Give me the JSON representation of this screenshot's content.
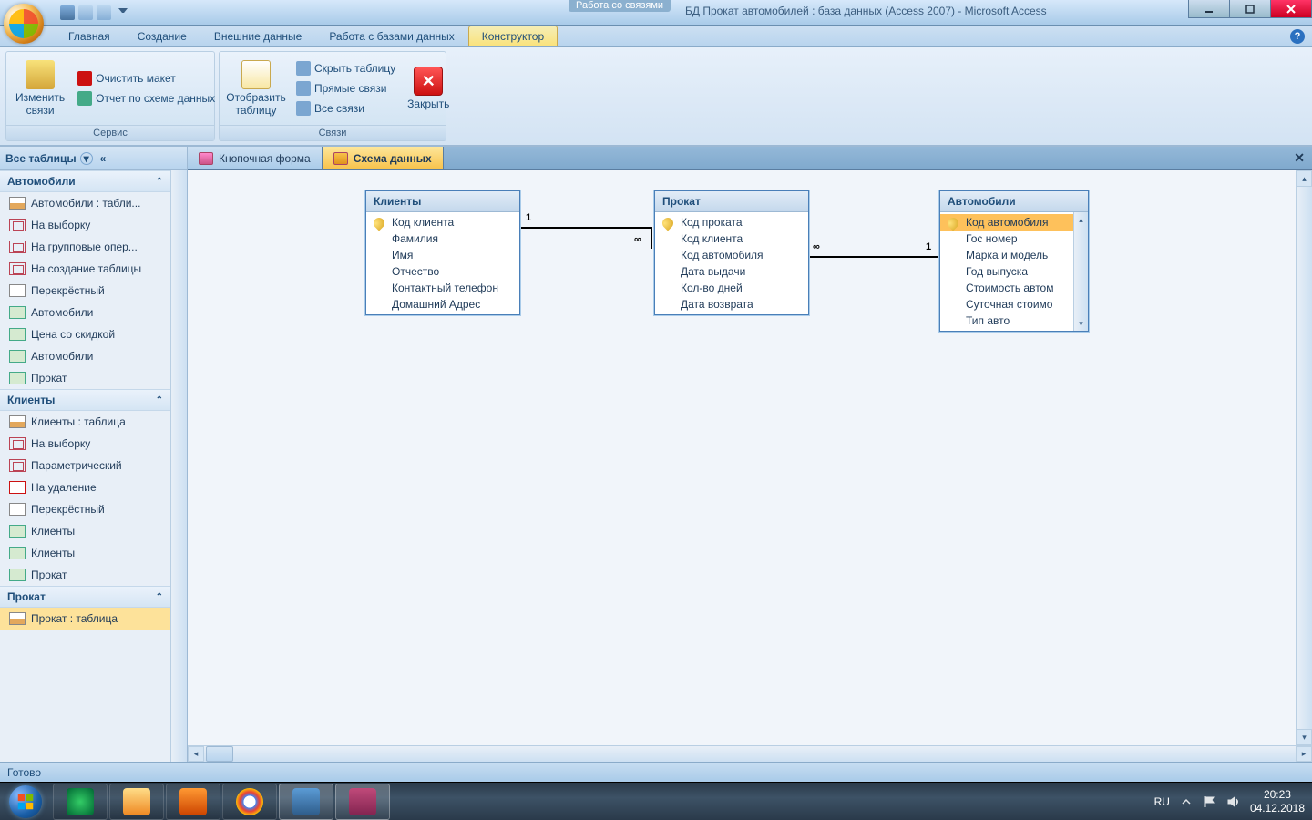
{
  "titlebar": {
    "context_tab": "Работа со связями",
    "title": "БД Прокат автомобилей : база данных (Access 2007) - Microsoft Access"
  },
  "ribbon_tabs": [
    "Главная",
    "Создание",
    "Внешние данные",
    "Работа с базами данных",
    "Конструктор"
  ],
  "active_ribbon_tab": "Конструктор",
  "ribbon": {
    "group1": {
      "label": "Сервис",
      "edit_btn_l1": "Изменить",
      "edit_btn_l2": "связи",
      "clear": "Очистить макет",
      "report": "Отчет по схеме данных"
    },
    "group2": {
      "label": "Связи",
      "show_table_l1": "Отобразить",
      "show_table_l2": "таблицу",
      "hide": "Скрыть таблицу",
      "direct": "Прямые связи",
      "all": "Все связи",
      "close": "Закрыть"
    }
  },
  "nav": {
    "header": "Все таблицы",
    "groups": [
      {
        "name": "Автомобили",
        "items": [
          {
            "t": "table",
            "l": "Автомобили : табли..."
          },
          {
            "t": "query",
            "l": "На выборку"
          },
          {
            "t": "query",
            "l": "На групповые опер..."
          },
          {
            "t": "query",
            "l": "На создание таблицы"
          },
          {
            "t": "cross",
            "l": "Перекрёстный"
          },
          {
            "t": "form",
            "l": "Автомобили"
          },
          {
            "t": "form",
            "l": "Цена со скидкой"
          },
          {
            "t": "report",
            "l": "Автомобили"
          },
          {
            "t": "report",
            "l": "Прокат"
          }
        ]
      },
      {
        "name": "Клиенты",
        "items": [
          {
            "t": "table",
            "l": "Клиенты : таблица"
          },
          {
            "t": "query",
            "l": "На выборку"
          },
          {
            "t": "query",
            "l": "Параметрический"
          },
          {
            "t": "del",
            "l": "На удаление"
          },
          {
            "t": "cross",
            "l": "Перекрёстный"
          },
          {
            "t": "form",
            "l": "Клиенты"
          },
          {
            "t": "report",
            "l": "Клиенты"
          },
          {
            "t": "report",
            "l": "Прокат"
          }
        ]
      },
      {
        "name": "Прокат",
        "items": [
          {
            "t": "table",
            "l": "Прокат : таблица",
            "sel": true
          }
        ]
      }
    ]
  },
  "doc_tabs": [
    {
      "label": "Кнопочная форма",
      "active": false
    },
    {
      "label": "Схема данных",
      "active": true
    }
  ],
  "tables": {
    "clients": {
      "title": "Клиенты",
      "fields": [
        {
          "n": "Код клиента",
          "k": true
        },
        {
          "n": "Фамилия"
        },
        {
          "n": "Имя"
        },
        {
          "n": "Отчество"
        },
        {
          "n": "Контактный телефон"
        },
        {
          "n": "Домашний Адрес"
        }
      ]
    },
    "rental": {
      "title": "Прокат",
      "fields": [
        {
          "n": "Код проката",
          "k": true
        },
        {
          "n": "Код клиента"
        },
        {
          "n": "Код автомобиля"
        },
        {
          "n": "Дата выдачи"
        },
        {
          "n": "Кол-во дней"
        },
        {
          "n": "Дата возврата"
        }
      ]
    },
    "cars": {
      "title": "Автомобили",
      "fields": [
        {
          "n": "Код автомобиля",
          "k": true,
          "sel": true
        },
        {
          "n": "Гос номер"
        },
        {
          "n": "Марка и модель"
        },
        {
          "n": "Год выпуска"
        },
        {
          "n": "Стоимость автом"
        },
        {
          "n": "Суточная стоимо"
        },
        {
          "n": "Тип авто"
        }
      ]
    }
  },
  "rel": {
    "one": "1",
    "many": "∞"
  },
  "status": "Готово",
  "tray": {
    "lang": "RU",
    "time": "20:23",
    "date": "04.12.2018"
  }
}
